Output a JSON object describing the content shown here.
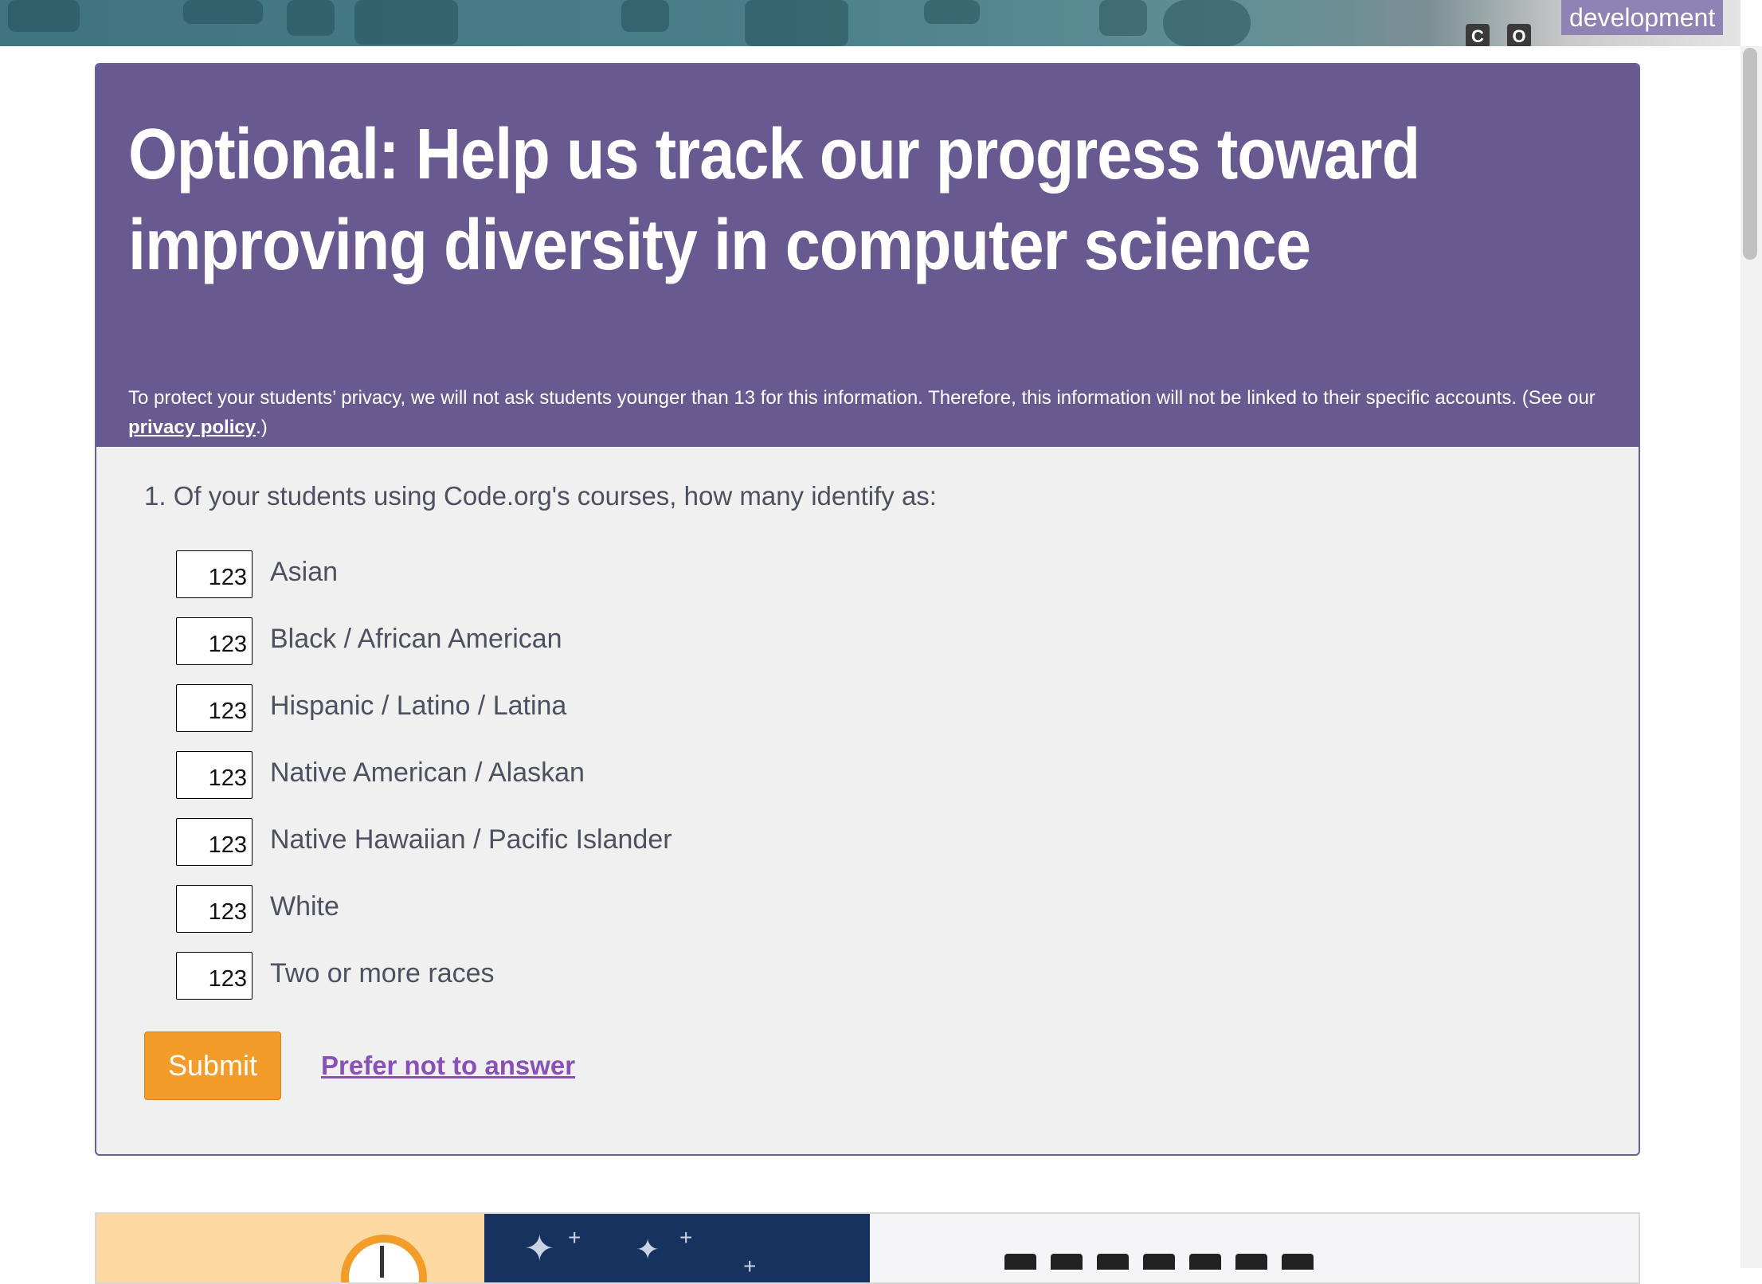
{
  "banner": {
    "environment_badge": "development",
    "logo_letters": [
      "C",
      "O"
    ]
  },
  "survey": {
    "title": "Optional: Help us track our progress toward improving diversity in computer science",
    "intro_before_link": "To protect your students’ privacy, we will not ask students younger than 13 for this information. Therefore, this information will not be linked to their specific accounts. (See our ",
    "intro_link": "privacy policy",
    "intro_after_link": ".)",
    "question": "1. Of your students using Code.org's courses, how many identify as:",
    "options": [
      {
        "value": "123",
        "label": "Asian"
      },
      {
        "value": "123",
        "label": "Black / African American"
      },
      {
        "value": "123",
        "label": "Hispanic / Latino / Latina"
      },
      {
        "value": "123",
        "label": "Native American / Alaskan"
      },
      {
        "value": "123",
        "label": "Native Hawaiian / Pacific Islander"
      },
      {
        "value": "123",
        "label": "White"
      },
      {
        "value": "123",
        "label": "Two or more races"
      }
    ],
    "submit_label": "Submit",
    "decline_label": "Prefer not to answer"
  },
  "promo": {
    "close_glyph": "✕"
  },
  "colors": {
    "header_purple": "#685a91",
    "submit_orange": "#f39c2a",
    "link_purple": "#8a50ba",
    "panel_gray": "#f0f0f0"
  },
  "icons": [
    "close-icon",
    "clock-icon",
    "star-icon"
  ]
}
